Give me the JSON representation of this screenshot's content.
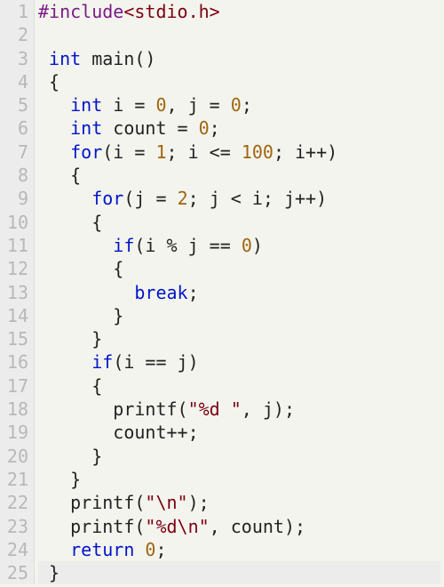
{
  "editor": {
    "line_numbers": [
      "1",
      "2",
      "3",
      "4",
      "5",
      "6",
      "7",
      "8",
      "9",
      "10",
      "11",
      "12",
      "13",
      "14",
      "15",
      "16",
      "17",
      "18",
      "19",
      "20",
      "21",
      "22",
      "23",
      "24",
      "25"
    ],
    "lines": [
      [
        {
          "t": "#include",
          "c": "pp"
        },
        {
          "t": "<stdio.h>",
          "c": "hdr"
        }
      ],
      [],
      [
        {
          "t": " ",
          "c": "op"
        },
        {
          "t": "int",
          "c": "kw"
        },
        {
          "t": " ",
          "c": "op"
        },
        {
          "t": "main",
          "c": "fn"
        },
        {
          "t": "()",
          "c": "op"
        }
      ],
      [
        {
          "t": " {",
          "c": "op"
        }
      ],
      [
        {
          "t": "   ",
          "c": "op"
        },
        {
          "t": "int",
          "c": "kw"
        },
        {
          "t": " i = ",
          "c": "op"
        },
        {
          "t": "0",
          "c": "num"
        },
        {
          "t": ", j = ",
          "c": "op"
        },
        {
          "t": "0",
          "c": "num"
        },
        {
          "t": ";",
          "c": "op"
        }
      ],
      [
        {
          "t": "   ",
          "c": "op"
        },
        {
          "t": "int",
          "c": "kw"
        },
        {
          "t": " count = ",
          "c": "op"
        },
        {
          "t": "0",
          "c": "num"
        },
        {
          "t": ";",
          "c": "op"
        }
      ],
      [
        {
          "t": "   ",
          "c": "op"
        },
        {
          "t": "for",
          "c": "kw"
        },
        {
          "t": "(i = ",
          "c": "op"
        },
        {
          "t": "1",
          "c": "num"
        },
        {
          "t": "; i <= ",
          "c": "op"
        },
        {
          "t": "100",
          "c": "num"
        },
        {
          "t": "; i++)",
          "c": "op"
        }
      ],
      [
        {
          "t": "   {",
          "c": "op"
        }
      ],
      [
        {
          "t": "     ",
          "c": "op"
        },
        {
          "t": "for",
          "c": "kw"
        },
        {
          "t": "(j = ",
          "c": "op"
        },
        {
          "t": "2",
          "c": "num"
        },
        {
          "t": "; j < i; j++)",
          "c": "op"
        }
      ],
      [
        {
          "t": "     {",
          "c": "op"
        }
      ],
      [
        {
          "t": "       ",
          "c": "op"
        },
        {
          "t": "if",
          "c": "kw"
        },
        {
          "t": "(i % j == ",
          "c": "op"
        },
        {
          "t": "0",
          "c": "num"
        },
        {
          "t": ")",
          "c": "op"
        }
      ],
      [
        {
          "t": "       {",
          "c": "op"
        }
      ],
      [
        {
          "t": "         ",
          "c": "op"
        },
        {
          "t": "break",
          "c": "kw"
        },
        {
          "t": ";",
          "c": "op"
        }
      ],
      [
        {
          "t": "       }",
          "c": "op"
        }
      ],
      [
        {
          "t": "     }",
          "c": "op"
        }
      ],
      [
        {
          "t": "     ",
          "c": "op"
        },
        {
          "t": "if",
          "c": "kw"
        },
        {
          "t": "(i == j)",
          "c": "op"
        }
      ],
      [
        {
          "t": "     {",
          "c": "op"
        }
      ],
      [
        {
          "t": "       printf(",
          "c": "op"
        },
        {
          "t": "\"%d \"",
          "c": "hdr"
        },
        {
          "t": ", j);",
          "c": "op"
        }
      ],
      [
        {
          "t": "       count++;",
          "c": "op"
        }
      ],
      [
        {
          "t": "     }",
          "c": "op"
        }
      ],
      [
        {
          "t": "   }",
          "c": "op"
        }
      ],
      [
        {
          "t": "   printf(",
          "c": "op"
        },
        {
          "t": "\"\\n\"",
          "c": "hdr"
        },
        {
          "t": ");",
          "c": "op"
        }
      ],
      [
        {
          "t": "   printf(",
          "c": "op"
        },
        {
          "t": "\"%d\\n\"",
          "c": "hdr"
        },
        {
          "t": ", count);",
          "c": "op"
        }
      ],
      [
        {
          "t": "   ",
          "c": "op"
        },
        {
          "t": "return",
          "c": "kw"
        },
        {
          "t": " ",
          "c": "op"
        },
        {
          "t": "0",
          "c": "num"
        },
        {
          "t": ";",
          "c": "op"
        }
      ],
      [
        {
          "t": " }",
          "c": "op"
        }
      ]
    ]
  }
}
